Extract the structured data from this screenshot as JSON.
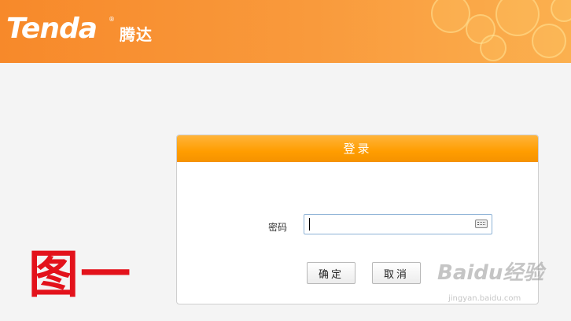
{
  "header": {
    "brand": "Tenda",
    "brand_cn": "腾达",
    "registered": "®"
  },
  "login": {
    "title": "登录",
    "password_label": "密码",
    "password_value": "",
    "confirm_label": "确定",
    "cancel_label": "取消"
  },
  "annotation": {
    "figure_label": "图一"
  },
  "watermark": {
    "text": "Baidu经验",
    "subtext": "jingyan.baidu.com"
  },
  "colors": {
    "header_orange": "#f7892a",
    "panel_header": "#ff9d00",
    "annotation_red": "#e3121b"
  },
  "icons": [
    "keyboard-icon"
  ]
}
